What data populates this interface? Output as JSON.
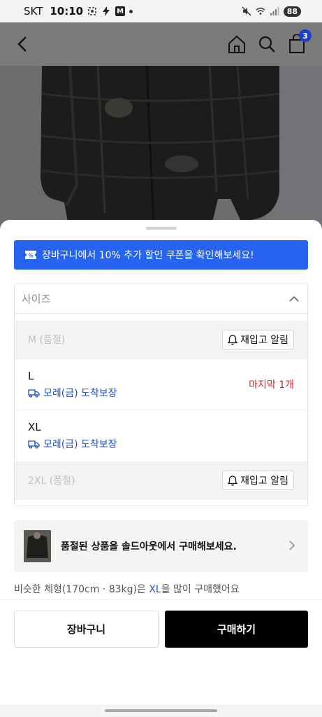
{
  "status_bar": {
    "carrier": "SKT",
    "time": "10:10",
    "m_badge": "M",
    "battery": "88"
  },
  "nav": {
    "cart_count": "3"
  },
  "sheet": {
    "coupon_text": "장바구니에서 10% 추가 할인 쿠폰을 확인해보세요!",
    "size_placeholder": "사이즈",
    "sizes": [
      {
        "label": "M (품절)",
        "action": "재입고 알림"
      },
      {
        "label": "L",
        "delivery": "모레(금) 도착보장",
        "stock": "마지막 1개"
      },
      {
        "label": "XL",
        "delivery": "모레(금) 도착보장"
      },
      {
        "label": "2XL (품절)",
        "action": "재입고 알림"
      }
    ],
    "soldout_promo": "품절된 상품을 솔드아웃에서 구매해보세요.",
    "reco": {
      "prefix": "비슷한 체형(170cm · 83kg)은 ",
      "highlight": "XL",
      "suffix": "을 많이 구매했어요"
    },
    "cart_button": "장바구니",
    "buy_button": "구매하기"
  },
  "colors": {
    "accent_blue": "#2563f0",
    "link_blue": "#1c4fd8",
    "alert_red": "#d6262d",
    "buy_black": "#000000"
  }
}
